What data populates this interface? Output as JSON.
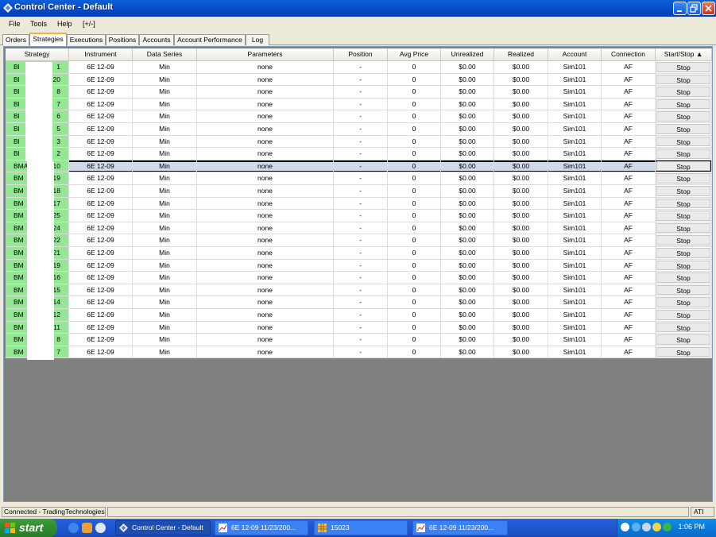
{
  "window": {
    "title": "Control Center - Default",
    "icon": "diamond-app-icon"
  },
  "menu": [
    "File",
    "Tools",
    "Help",
    "[+/-]"
  ],
  "tabs": [
    {
      "label": "Orders",
      "active": false
    },
    {
      "label": "Strategies",
      "active": true
    },
    {
      "label": "Executions",
      "active": false
    },
    {
      "label": "Positions",
      "active": false
    },
    {
      "label": "Accounts",
      "active": false
    },
    {
      "label": "Account Performance",
      "active": false
    },
    {
      "label": "Log",
      "active": false
    }
  ],
  "grid": {
    "columns": [
      "Strategy",
      "Instrument",
      "Data Series",
      "Parameters",
      "Position",
      "Avg Price",
      "Unrealized",
      "Realized",
      "Account",
      "Connection",
      "Start/Stop  ▲"
    ],
    "rows": [
      {
        "strategy_prefix": "Bl",
        "strategy_suffix": "1",
        "instrument": "6E 12-09",
        "data_series": "Min",
        "parameters": "none",
        "position": "-",
        "avg_price": "0",
        "unrealized": "$0.00",
        "realized": "$0.00",
        "account": "Sim101",
        "connection": "AF",
        "action": "Stop"
      },
      {
        "strategy_prefix": "Bl",
        "strategy_suffix": "20",
        "instrument": "6E 12-09",
        "data_series": "Min",
        "parameters": "none",
        "position": "-",
        "avg_price": "0",
        "unrealized": "$0.00",
        "realized": "$0.00",
        "account": "Sim101",
        "connection": "AF",
        "action": "Stop"
      },
      {
        "strategy_prefix": "Bl",
        "strategy_suffix": "8",
        "instrument": "6E 12-09",
        "data_series": "Min",
        "parameters": "none",
        "position": "-",
        "avg_price": "0",
        "unrealized": "$0.00",
        "realized": "$0.00",
        "account": "Sim101",
        "connection": "AF",
        "action": "Stop"
      },
      {
        "strategy_prefix": "Bl",
        "strategy_suffix": "7",
        "instrument": "6E 12-09",
        "data_series": "Min",
        "parameters": "none",
        "position": "-",
        "avg_price": "0",
        "unrealized": "$0.00",
        "realized": "$0.00",
        "account": "Sim101",
        "connection": "AF",
        "action": "Stop"
      },
      {
        "strategy_prefix": "Bl",
        "strategy_suffix": "6",
        "instrument": "6E 12-09",
        "data_series": "Min",
        "parameters": "none",
        "position": "-",
        "avg_price": "0",
        "unrealized": "$0.00",
        "realized": "$0.00",
        "account": "Sim101",
        "connection": "AF",
        "action": "Stop"
      },
      {
        "strategy_prefix": "Bl",
        "strategy_suffix": "5",
        "instrument": "6E 12-09",
        "data_series": "Min",
        "parameters": "none",
        "position": "-",
        "avg_price": "0",
        "unrealized": "$0.00",
        "realized": "$0.00",
        "account": "Sim101",
        "connection": "AF",
        "action": "Stop"
      },
      {
        "strategy_prefix": "Bl",
        "strategy_suffix": "3",
        "instrument": "6E 12-09",
        "data_series": "Min",
        "parameters": "none",
        "position": "-",
        "avg_price": "0",
        "unrealized": "$0.00",
        "realized": "$0.00",
        "account": "Sim101",
        "connection": "AF",
        "action": "Stop"
      },
      {
        "strategy_prefix": "Bl",
        "strategy_suffix": "2",
        "instrument": "6E 12-09",
        "data_series": "Min",
        "parameters": "none",
        "position": "-",
        "avg_price": "0",
        "unrealized": "$0.00",
        "realized": "$0.00",
        "account": "Sim101",
        "connection": "AF",
        "action": "Stop"
      },
      {
        "strategy_prefix": "BMA",
        "strategy_suffix": "10",
        "instrument": "6E 12-09",
        "data_series": "Min",
        "parameters": "none",
        "position": "-",
        "avg_price": "0",
        "unrealized": "$0.00",
        "realized": "$0.00",
        "account": "Sim101",
        "connection": "AF",
        "action": "Stop",
        "selected": true
      },
      {
        "strategy_prefix": "BM",
        "strategy_suffix": "19",
        "instrument": "6E 12-09",
        "data_series": "Min",
        "parameters": "none",
        "position": "-",
        "avg_price": "0",
        "unrealized": "$0.00",
        "realized": "$0.00",
        "account": "Sim101",
        "connection": "AF",
        "action": "Stop"
      },
      {
        "strategy_prefix": "BM",
        "strategy_suffix": "18",
        "instrument": "6E 12-09",
        "data_series": "Min",
        "parameters": "none",
        "position": "-",
        "avg_price": "0",
        "unrealized": "$0.00",
        "realized": "$0.00",
        "account": "Sim101",
        "connection": "AF",
        "action": "Stop"
      },
      {
        "strategy_prefix": "BM",
        "strategy_suffix": "17",
        "instrument": "6E 12-09",
        "data_series": "Min",
        "parameters": "none",
        "position": "-",
        "avg_price": "0",
        "unrealized": "$0.00",
        "realized": "$0.00",
        "account": "Sim101",
        "connection": "AF",
        "action": "Stop"
      },
      {
        "strategy_prefix": "BM",
        "strategy_suffix": "25",
        "instrument": "6E 12-09",
        "data_series": "Min",
        "parameters": "none",
        "position": "-",
        "avg_price": "0",
        "unrealized": "$0.00",
        "realized": "$0.00",
        "account": "Sim101",
        "connection": "AF",
        "action": "Stop"
      },
      {
        "strategy_prefix": "BM",
        "strategy_suffix": "24",
        "instrument": "6E 12-09",
        "data_series": "Min",
        "parameters": "none",
        "position": "-",
        "avg_price": "0",
        "unrealized": "$0.00",
        "realized": "$0.00",
        "account": "Sim101",
        "connection": "AF",
        "action": "Stop"
      },
      {
        "strategy_prefix": "BM",
        "strategy_suffix": "22",
        "instrument": "6E 12-09",
        "data_series": "Min",
        "parameters": "none",
        "position": "-",
        "avg_price": "0",
        "unrealized": "$0.00",
        "realized": "$0.00",
        "account": "Sim101",
        "connection": "AF",
        "action": "Stop"
      },
      {
        "strategy_prefix": "BM",
        "strategy_suffix": "21",
        "instrument": "6E 12-09",
        "data_series": "Min",
        "parameters": "none",
        "position": "-",
        "avg_price": "0",
        "unrealized": "$0.00",
        "realized": "$0.00",
        "account": "Sim101",
        "connection": "AF",
        "action": "Stop"
      },
      {
        "strategy_prefix": "BM",
        "strategy_suffix": "19",
        "instrument": "6E 12-09",
        "data_series": "Min",
        "parameters": "none",
        "position": "-",
        "avg_price": "0",
        "unrealized": "$0.00",
        "realized": "$0.00",
        "account": "Sim101",
        "connection": "AF",
        "action": "Stop"
      },
      {
        "strategy_prefix": "BM",
        "strategy_suffix": "16",
        "instrument": "6E 12-09",
        "data_series": "Min",
        "parameters": "none",
        "position": "-",
        "avg_price": "0",
        "unrealized": "$0.00",
        "realized": "$0.00",
        "account": "Sim101",
        "connection": "AF",
        "action": "Stop"
      },
      {
        "strategy_prefix": "BM",
        "strategy_suffix": "15",
        "instrument": "6E 12-09",
        "data_series": "Min",
        "parameters": "none",
        "position": "-",
        "avg_price": "0",
        "unrealized": "$0.00",
        "realized": "$0.00",
        "account": "Sim101",
        "connection": "AF",
        "action": "Stop"
      },
      {
        "strategy_prefix": "BM",
        "strategy_suffix": "14",
        "instrument": "6E 12-09",
        "data_series": "Min",
        "parameters": "none",
        "position": "-",
        "avg_price": "0",
        "unrealized": "$0.00",
        "realized": "$0.00",
        "account": "Sim101",
        "connection": "AF",
        "action": "Stop"
      },
      {
        "strategy_prefix": "BM",
        "strategy_suffix": "12",
        "instrument": "6E 12-09",
        "data_series": "Min",
        "parameters": "none",
        "position": "-",
        "avg_price": "0",
        "unrealized": "$0.00",
        "realized": "$0.00",
        "account": "Sim101",
        "connection": "AF",
        "action": "Stop"
      },
      {
        "strategy_prefix": "BM",
        "strategy_suffix": "11",
        "instrument": "6E 12-09",
        "data_series": "Min",
        "parameters": "none",
        "position": "-",
        "avg_price": "0",
        "unrealized": "$0.00",
        "realized": "$0.00",
        "account": "Sim101",
        "connection": "AF",
        "action": "Stop"
      },
      {
        "strategy_prefix": "BM",
        "strategy_suffix": "8",
        "instrument": "6E 12-09",
        "data_series": "Min",
        "parameters": "none",
        "position": "-",
        "avg_price": "0",
        "unrealized": "$0.00",
        "realized": "$0.00",
        "account": "Sim101",
        "connection": "AF",
        "action": "Stop"
      },
      {
        "strategy_prefix": "BM",
        "strategy_suffix": "7",
        "instrument": "6E 12-09",
        "data_series": "Min",
        "parameters": "none",
        "position": "-",
        "avg_price": "0",
        "unrealized": "$0.00",
        "realized": "$0.00",
        "account": "Sim101",
        "connection": "AF",
        "action": "Stop"
      }
    ]
  },
  "status": {
    "connection": "Connected - TradingTechnologies",
    "right": "ATI"
  },
  "taskbar": {
    "start_label": "start",
    "buttons": [
      {
        "label": "Control Center - Default",
        "active": true,
        "icon": "diamond-app-icon"
      },
      {
        "label": "6E 12-09  11/23/200...",
        "active": false,
        "icon": "chart-icon"
      },
      {
        "label": "15023",
        "active": false,
        "icon": "grid-icon"
      },
      {
        "label": "6E 12-09  11/23/200...",
        "active": false,
        "icon": "chart-icon"
      }
    ],
    "clock": "1:06 PM"
  },
  "colors": {
    "strategy_running": "#94e894",
    "selected_row": "#d0d9e8",
    "grid_background": "#808080"
  }
}
